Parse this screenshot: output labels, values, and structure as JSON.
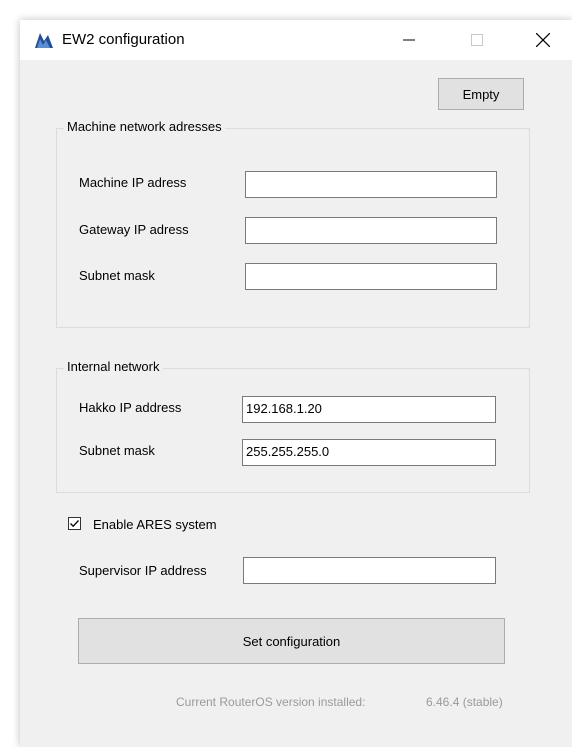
{
  "window": {
    "title": "EW2 configuration",
    "controls": {
      "minimize": "minimize-icon",
      "maximize": "maximize-icon",
      "close": "close-icon"
    }
  },
  "buttons": {
    "empty": "Empty",
    "set_configuration": "Set configuration"
  },
  "machine_network": {
    "title": "Machine network adresses",
    "fields": [
      {
        "label": "Machine IP adress",
        "value": ""
      },
      {
        "label": "Gateway IP adress",
        "value": ""
      },
      {
        "label": "Subnet mask",
        "value": ""
      }
    ]
  },
  "internal_network": {
    "title": "Internal network",
    "fields": [
      {
        "label": "Hakko IP address",
        "value": "192.168.1.20"
      },
      {
        "label": "Subnet mask",
        "value": "255.255.255.0"
      }
    ]
  },
  "ares": {
    "checkbox_label": "Enable ARES system",
    "checked": true,
    "supervisor_label": "Supervisor IP address",
    "supervisor_value": ""
  },
  "footer": {
    "version_label": "Current RouterOS version installed:",
    "version_value": "6.46.4 (stable)"
  }
}
